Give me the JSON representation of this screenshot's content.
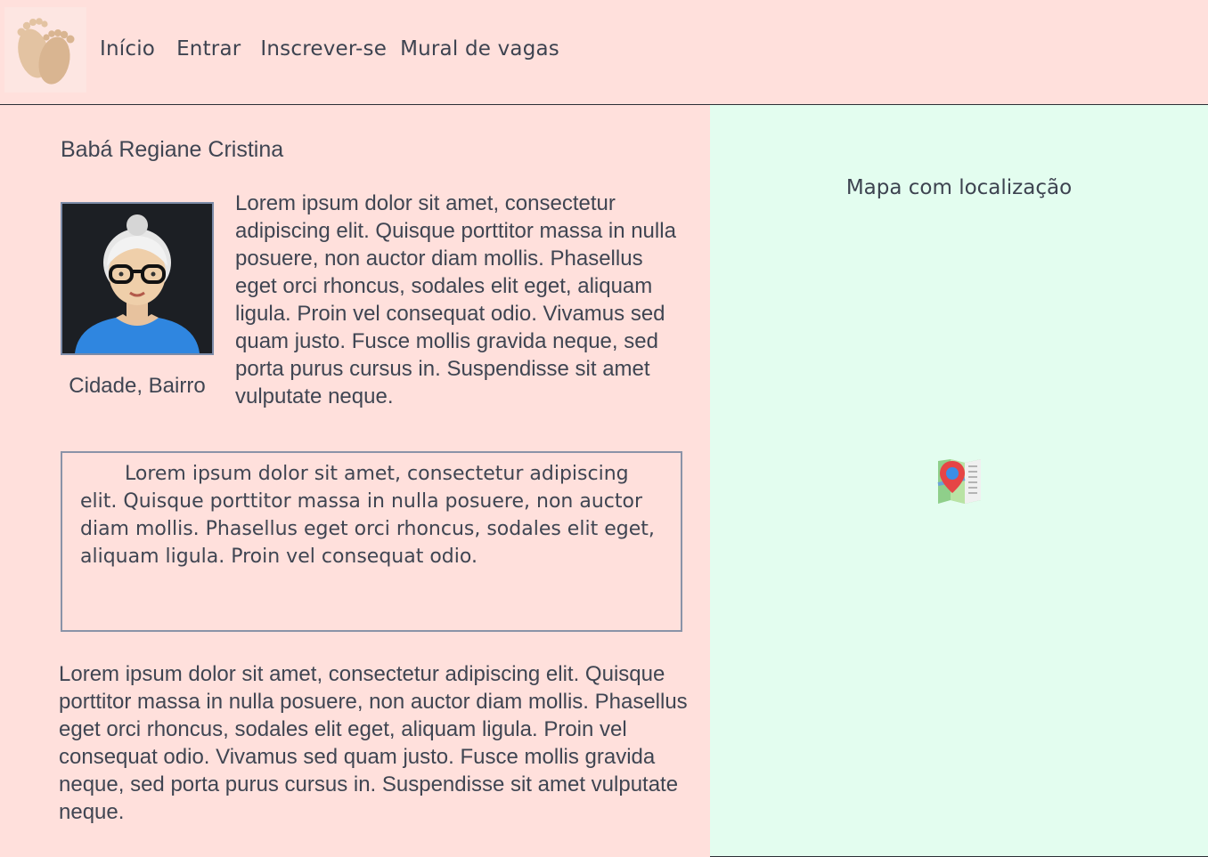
{
  "nav": {
    "items": [
      "Início",
      "Entrar",
      "Inscrever-se",
      "Mural de vagas"
    ]
  },
  "profile": {
    "name": "Babá Regiane Cristina",
    "location": "Cidade, Bairro",
    "bio": "Lorem ipsum dolor sit amet, consectetur adipiscing elit. Quisque porttitor massa in nulla posuere, non auctor diam mollis. Phasellus eget orci rhoncus, sodales elit eget, aliquam ligula. Proin vel consequat odio. Vivamus sed quam justo. Fusce mollis gravida neque, sed porta purus cursus in. Suspendisse sit amet vulputate neque.",
    "highlight": "Lorem ipsum dolor sit amet, consectetur adipiscing elit. Quisque porttitor massa in nulla posuere, non auctor diam mollis. Phasellus eget orci rhoncus, sodales elit eget, aliquam ligula. Proin vel consequat odio.",
    "details": "Lorem ipsum dolor sit amet, consectetur adipiscing elit. Quisque porttitor massa in nulla posuere, non auctor diam mollis. Phasellus eget orci rhoncus, sodales elit eget, aliquam ligula. Proin vel consequat odio. Vivamus sed quam justo. Fusce mollis gravida neque, sed porta purus cursus in. Suspendisse sit amet vulputate neque."
  },
  "map": {
    "title": "Mapa com localização",
    "icon": "map-pin-icon"
  },
  "icons": {
    "logo": "baby-feet-icon",
    "avatar": "grandmother-avatar-icon"
  },
  "colors": {
    "page_bg": "#ffe0dc",
    "map_bg": "#e3fdef",
    "text": "#3f4552",
    "box_border": "#8a93a8"
  }
}
